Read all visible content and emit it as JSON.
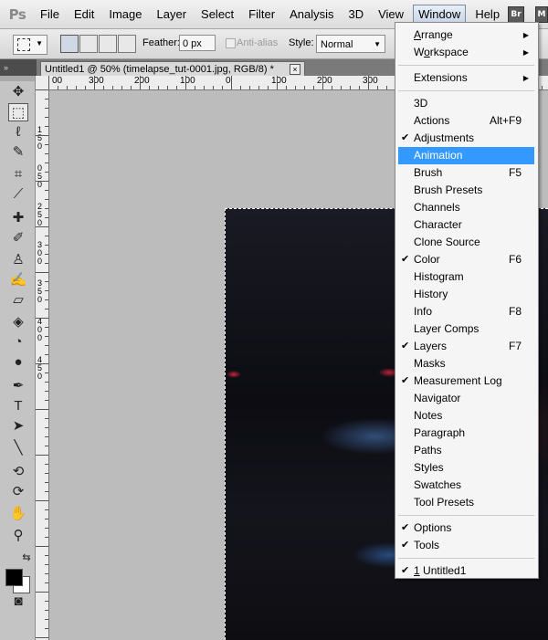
{
  "menubar": {
    "logo": "Ps",
    "items": [
      "File",
      "Edit",
      "Image",
      "Layer",
      "Select",
      "Filter",
      "Analysis",
      "3D",
      "View",
      "Window",
      "Help"
    ],
    "active": "Window",
    "app_buttons": [
      "Br",
      "M"
    ]
  },
  "options": {
    "feather_label": "Feather:",
    "feather_value": "0 px",
    "antialias_label": "Anti-alias",
    "style_label": "Style:",
    "style_value": "Normal"
  },
  "doc_tab": {
    "collapse_glyph": "»",
    "title": "Untitled1 @ 50% (timelapse_tut-0001.jpg, RGB/8) *",
    "close_glyph": "×"
  },
  "ruler": {
    "h_labels": [
      "00",
      "300",
      "200",
      "100",
      "0",
      "100",
      "200",
      "300"
    ],
    "v_labels": [
      "1",
      "5",
      "0",
      "0",
      "5",
      "0",
      "2",
      "5",
      "0",
      "3",
      "0",
      "0",
      "3",
      "5",
      "0",
      "4",
      "0",
      "0",
      "4",
      "5",
      "0"
    ]
  },
  "tools": [
    {
      "name": "move-tool-icon",
      "glyph": "✥"
    },
    {
      "name": "marquee-tool-icon",
      "glyph": "⬚"
    },
    {
      "name": "lasso-tool-icon",
      "glyph": "ℓ"
    },
    {
      "name": "quick-select-tool-icon",
      "glyph": "✎"
    },
    {
      "name": "crop-tool-icon",
      "glyph": "⌗"
    },
    {
      "name": "eyedropper-tool-icon",
      "glyph": "⟋"
    },
    {
      "name": "healing-tool-icon",
      "glyph": "✚"
    },
    {
      "name": "brush-tool-icon",
      "glyph": "✐"
    },
    {
      "name": "clone-stamp-tool-icon",
      "glyph": "♙"
    },
    {
      "name": "history-brush-tool-icon",
      "glyph": "✍"
    },
    {
      "name": "eraser-tool-icon",
      "glyph": "▱"
    },
    {
      "name": "paint-bucket-tool-icon",
      "glyph": "◈"
    },
    {
      "name": "blur-tool-icon",
      "glyph": "◔"
    },
    {
      "name": "dodge-tool-icon",
      "glyph": "●"
    },
    {
      "name": "pen-tool-icon",
      "glyph": "✒"
    },
    {
      "name": "type-tool-icon",
      "glyph": "T"
    },
    {
      "name": "path-select-tool-icon",
      "glyph": "➤"
    },
    {
      "name": "line-tool-icon",
      "glyph": "╲"
    },
    {
      "name": "3d-rotate-tool-icon",
      "glyph": "⟲"
    },
    {
      "name": "3d-orbit-tool-icon",
      "glyph": "⟳"
    },
    {
      "name": "hand-tool-icon",
      "glyph": "✋"
    },
    {
      "name": "zoom-tool-icon",
      "glyph": "⚲"
    },
    {
      "name": "swap-colors-icon",
      "glyph": "⇆"
    },
    {
      "name": "quick-mask-icon",
      "glyph": "◙"
    }
  ],
  "window_menu": {
    "items": [
      {
        "label": "Arrange",
        "mnemonic_index": 0,
        "submenu": true
      },
      {
        "label": "Workspace",
        "mnemonic_index": 1,
        "submenu": true
      },
      {
        "separator": true
      },
      {
        "label": "Extensions",
        "submenu": true
      },
      {
        "separator": true
      },
      {
        "label": "3D"
      },
      {
        "label": "Actions",
        "shortcut": "Alt+F9"
      },
      {
        "label": "Adjustments",
        "checked": true
      },
      {
        "label": "Animation",
        "highlighted": true
      },
      {
        "label": "Brush",
        "shortcut": "F5"
      },
      {
        "label": "Brush Presets"
      },
      {
        "label": "Channels"
      },
      {
        "label": "Character"
      },
      {
        "label": "Clone Source"
      },
      {
        "label": "Color",
        "shortcut": "F6",
        "checked": true
      },
      {
        "label": "Histogram"
      },
      {
        "label": "History"
      },
      {
        "label": "Info",
        "shortcut": "F8"
      },
      {
        "label": "Layer Comps"
      },
      {
        "label": "Layers",
        "shortcut": "F7",
        "checked": true
      },
      {
        "label": "Masks"
      },
      {
        "label": "Measurement Log",
        "checked": true
      },
      {
        "label": "Navigator"
      },
      {
        "label": "Notes"
      },
      {
        "label": "Paragraph"
      },
      {
        "label": "Paths"
      },
      {
        "label": "Styles"
      },
      {
        "label": "Swatches"
      },
      {
        "label": "Tool Presets"
      },
      {
        "separator": true
      },
      {
        "label": "Options",
        "checked": true
      },
      {
        "label": "Tools",
        "checked": true
      },
      {
        "separator": true
      },
      {
        "label": "1 Untitled1",
        "checked": true
      }
    ]
  },
  "colors": {
    "menu_highlight": "#3399ff",
    "foreground_swatch": "#000000",
    "background_swatch": "#ffffff"
  }
}
